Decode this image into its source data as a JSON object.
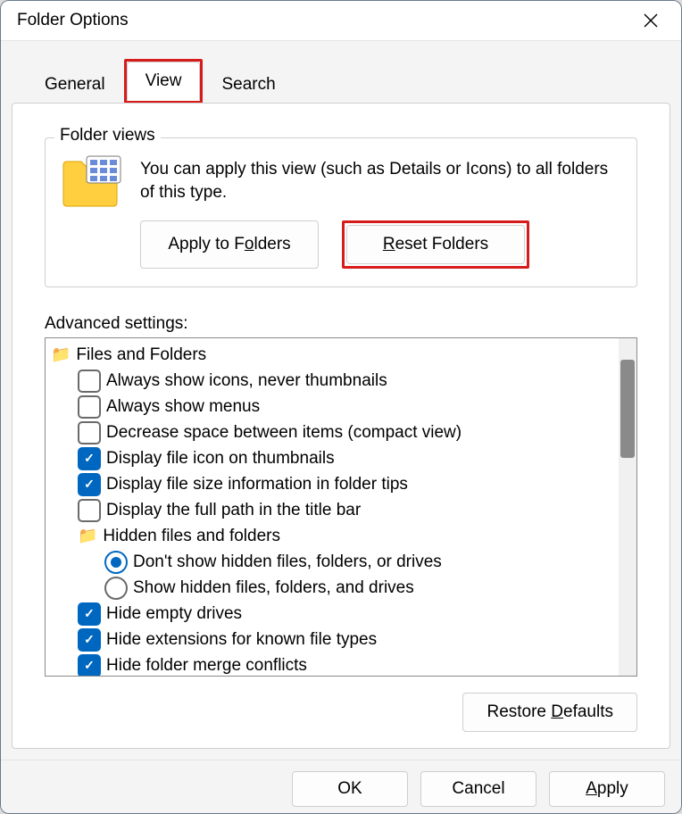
{
  "window": {
    "title": "Folder Options"
  },
  "tabs": {
    "general": "General",
    "view": "View",
    "search": "Search",
    "active": "view"
  },
  "folderViews": {
    "legend": "Folder views",
    "description": "You can apply this view (such as Details or Icons) to all folders of this type.",
    "applyPrefix": "Apply to F",
    "applyUL": "o",
    "applySuffix": "lders",
    "resetUL": "R",
    "resetSuffix": "eset Folders"
  },
  "advanced": {
    "label": "Advanced settings:",
    "root": "Files and Folders",
    "items": [
      {
        "type": "check",
        "checked": false,
        "label": "Always show icons, never thumbnails"
      },
      {
        "type": "check",
        "checked": false,
        "label": "Always show menus"
      },
      {
        "type": "check",
        "checked": false,
        "label": "Decrease space between items (compact view)"
      },
      {
        "type": "check",
        "checked": true,
        "label": "Display file icon on thumbnails"
      },
      {
        "type": "check",
        "checked": true,
        "label": "Display file size information in folder tips"
      },
      {
        "type": "check",
        "checked": false,
        "label": "Display the full path in the title bar"
      },
      {
        "type": "folder",
        "label": "Hidden files and folders",
        "children": [
          {
            "type": "radio",
            "checked": true,
            "label": "Don't show hidden files, folders, or drives"
          },
          {
            "type": "radio",
            "checked": false,
            "label": "Show hidden files, folders, and drives"
          }
        ]
      },
      {
        "type": "check",
        "checked": true,
        "label": "Hide empty drives"
      },
      {
        "type": "check",
        "checked": true,
        "label": "Hide extensions for known file types"
      },
      {
        "type": "check",
        "checked": true,
        "label": "Hide folder merge conflicts"
      }
    ]
  },
  "restore": {
    "prefix": "Restore ",
    "ul": "D",
    "suffix": "efaults"
  },
  "footer": {
    "ok": "OK",
    "cancel": "Cancel",
    "applyUL": "A",
    "applySuffix": "pply"
  }
}
